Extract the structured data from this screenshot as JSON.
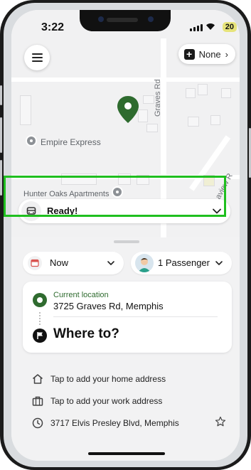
{
  "status_bar": {
    "time": "3:22",
    "battery": "20"
  },
  "header": {
    "none_button_label": "None",
    "none_chevron": "›"
  },
  "map": {
    "road_labels": [
      "Graves Rd",
      "Laview R"
    ],
    "pois": [
      "Empire Express",
      "Hunter Oaks Apartments"
    ],
    "pin_color": "#2e6b2e"
  },
  "ready_bar": {
    "label": "Ready!"
  },
  "booking": {
    "time_pill": "Now",
    "passenger_pill": "1 Passenger",
    "pickup_label": "Current location",
    "pickup_address": "3725 Graves Rd, Memphis",
    "destination_prompt": "Where to?"
  },
  "saved_places": [
    {
      "icon": "home-icon",
      "label": "Tap to add your home address"
    },
    {
      "icon": "briefcase-icon",
      "label": "Tap to add your work address"
    },
    {
      "icon": "clock-icon",
      "label": "3717 Elvis Presley Blvd, Memphis"
    }
  ],
  "colors": {
    "highlight": "#1fbf1f",
    "accent_green": "#2f6b2f",
    "battery": "#e6e37a"
  }
}
